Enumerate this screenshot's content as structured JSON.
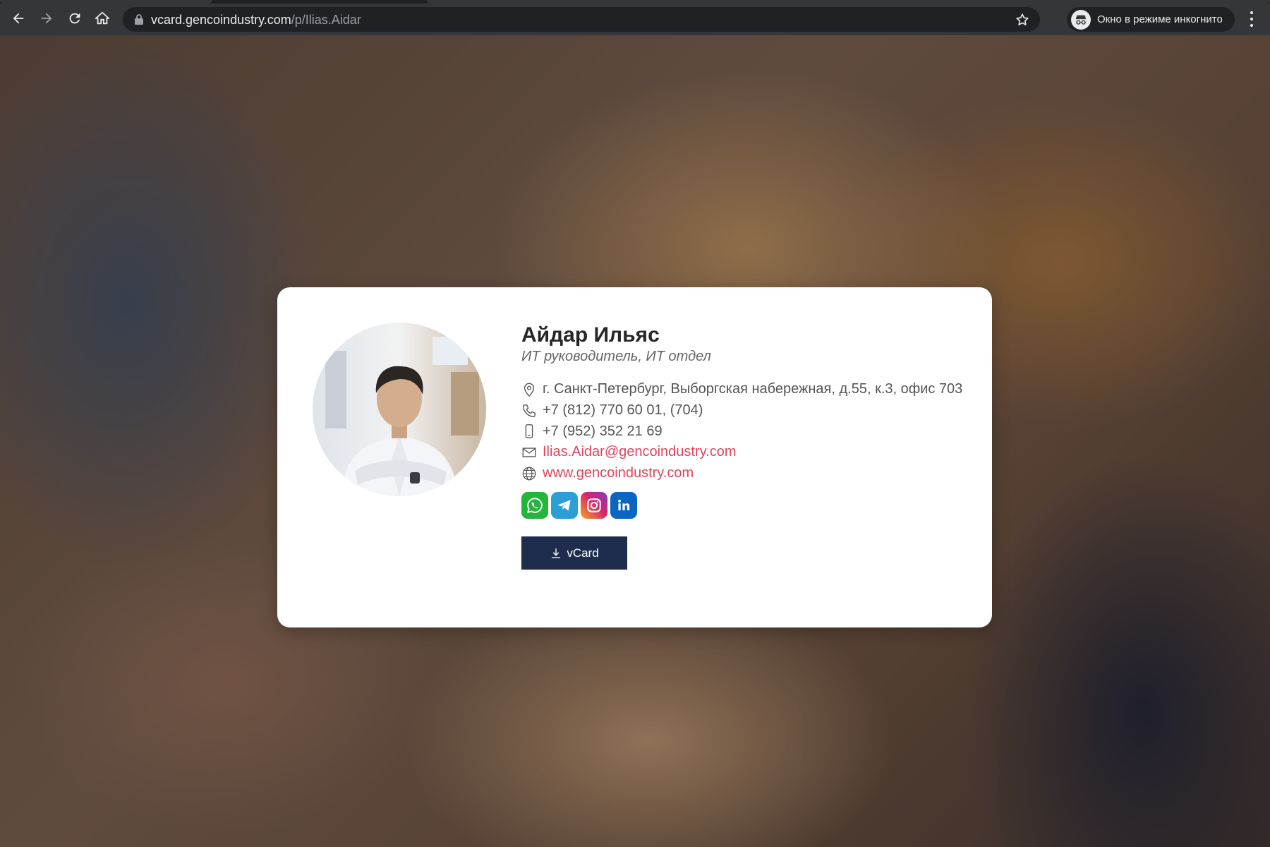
{
  "browser": {
    "url_host": "vcard.gencoindustry.com",
    "url_path": "/p/Ilias.Aidar",
    "incognito_label": "Окно в режиме инкогнито"
  },
  "profile": {
    "name": "Айдар Ильяс",
    "position": "ИТ руководитель, ИТ отдел",
    "address": "г. Санкт-Петербург, Выборгская набережная, д.55, к.3, офис 703",
    "phone": "+7 (812) 770 60 01, (704)",
    "mobile": "+7 (952) 352 21 69",
    "email": "Ilias.Aidar@gencoindustry.com",
    "website": "www.gencoindustry.com"
  },
  "socials": [
    {
      "icon": "whatsapp-icon",
      "color": "#25b53c"
    },
    {
      "icon": "telegram-icon",
      "color": "#2a9fd8"
    },
    {
      "icon": "instagram-icon",
      "color": "#c1357f"
    },
    {
      "icon": "linkedin-icon",
      "color": "#0a66c2"
    }
  ],
  "vcard_button": {
    "label": "vCard",
    "color": "#1e2d4e"
  },
  "colors": {
    "link": "#e0445c",
    "text": "#555555"
  }
}
